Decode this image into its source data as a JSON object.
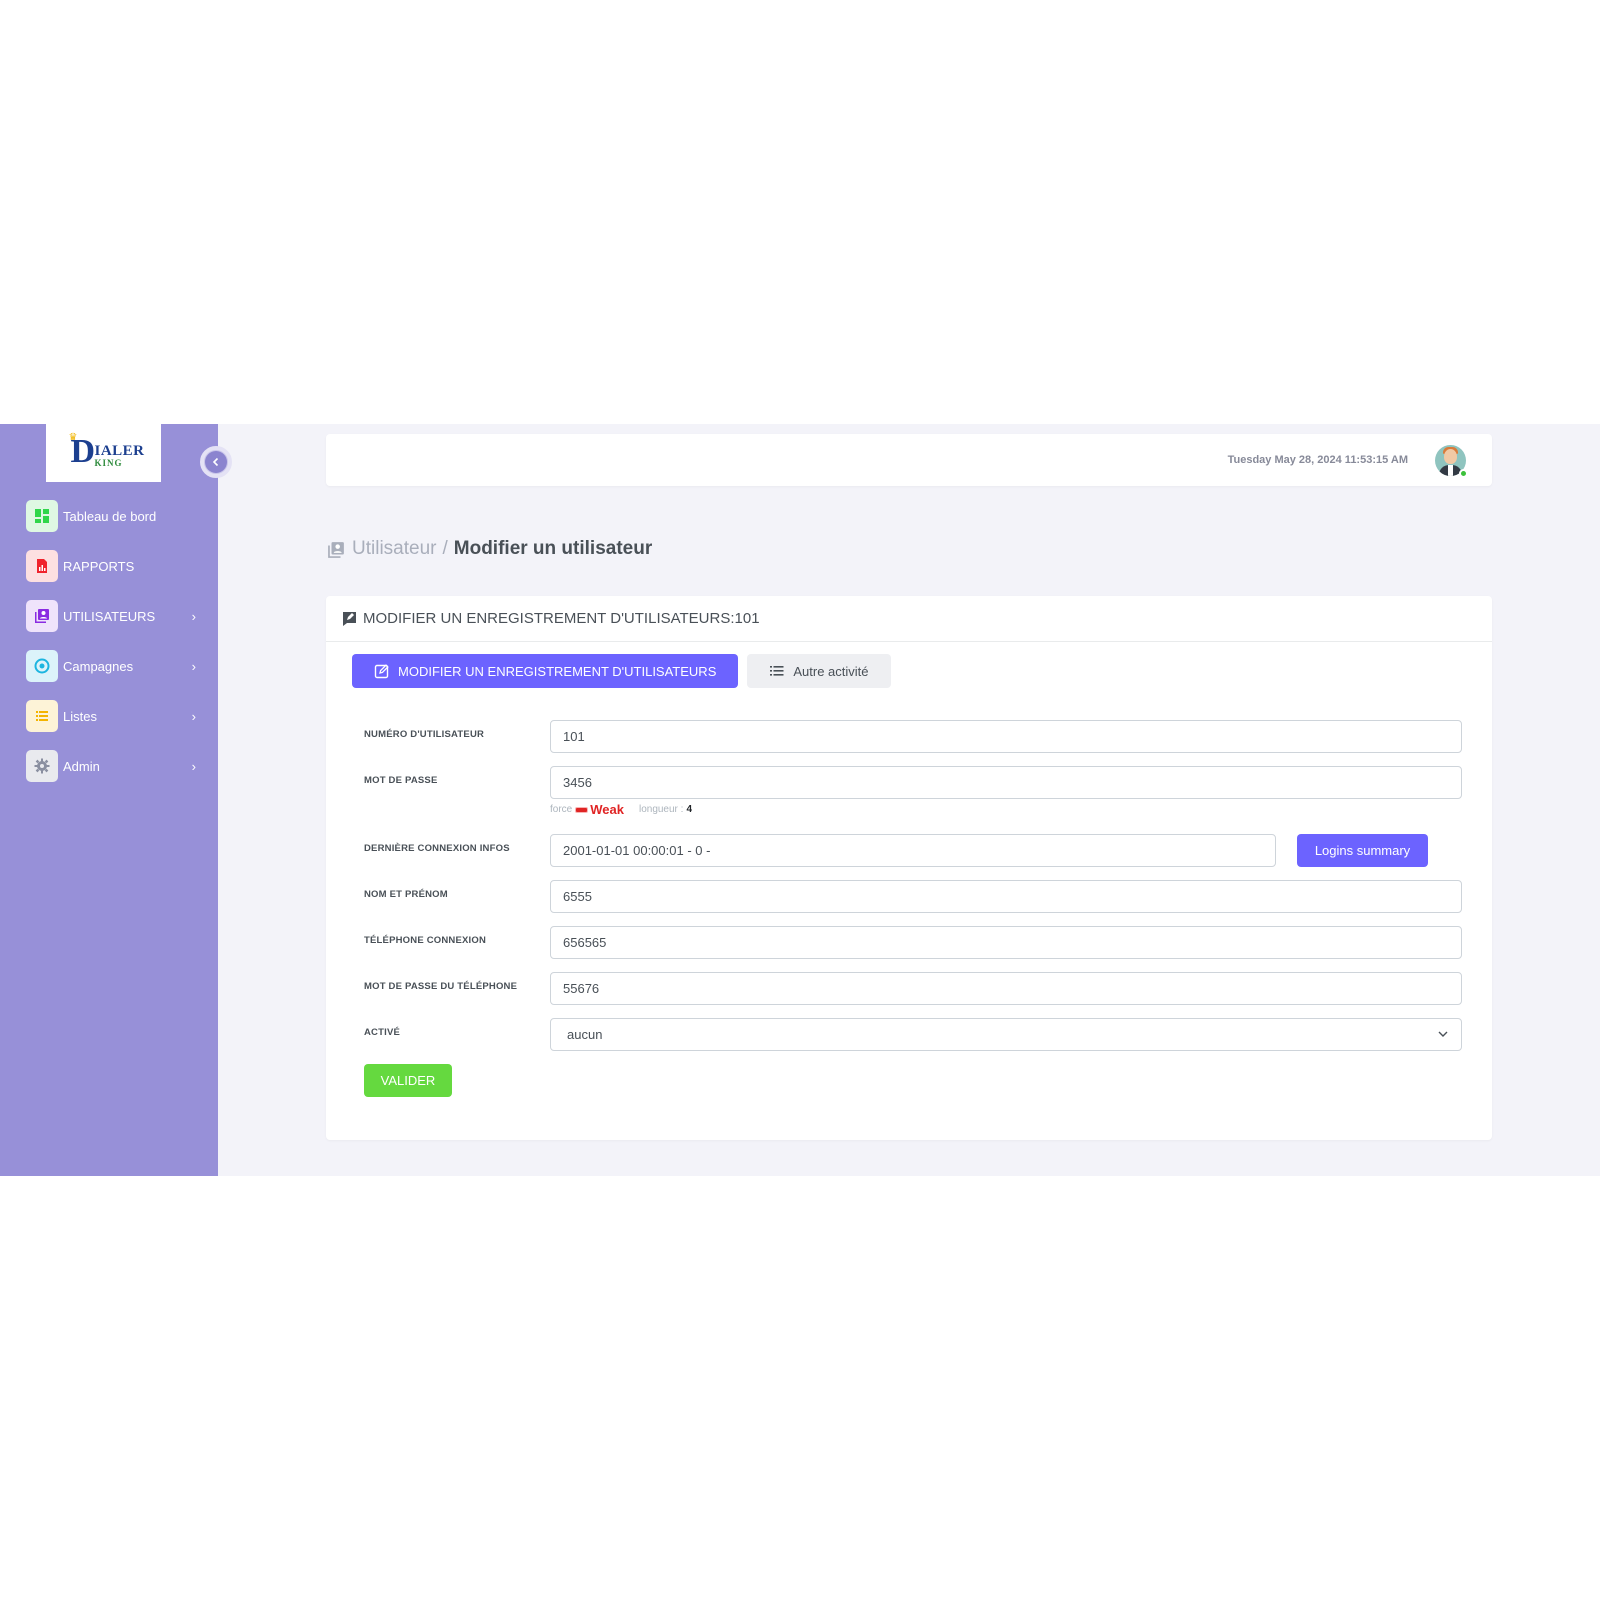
{
  "brand": {
    "logo_letter": "D",
    "logo_text_1": "IALER",
    "logo_text_2": "KING"
  },
  "sidebar": {
    "items": [
      {
        "label": "Tableau de bord",
        "icon": "dashboard-icon",
        "color": "#2fd64a",
        "bg": "#dff8e3",
        "has_submenu": false
      },
      {
        "label": "RAPPORTS",
        "icon": "report-file-icon",
        "color": "#f0232c",
        "bg": "#fde0e1",
        "has_submenu": false
      },
      {
        "label": "UTILISATEURS",
        "icon": "users-icon",
        "color": "#8a2be2",
        "bg": "#efe3fb",
        "has_submenu": true
      },
      {
        "label": "Campagnes",
        "icon": "target-icon",
        "color": "#1cb5e0",
        "bg": "#dcf3fa",
        "has_submenu": true
      },
      {
        "label": "Listes",
        "icon": "list-icon",
        "color": "#f4b400",
        "bg": "#fdf3d7",
        "has_submenu": true
      },
      {
        "label": "Admin",
        "icon": "gear-icon",
        "color": "#8a8fa0",
        "bg": "#e9eaee",
        "has_submenu": true
      }
    ]
  },
  "topbar": {
    "datetime": "Tuesday May 28, 2024 11:53:15 AM"
  },
  "breadcrumb": {
    "parent": "Utilisateur",
    "separator": "/",
    "current": "Modifier un utilisateur"
  },
  "card": {
    "title": "MODIFIER UN ENREGISTREMENT D'UTILISATEURS:101",
    "tabs": {
      "active": "MODIFIER UN ENREGISTREMENT D'UTILISATEURS",
      "other": "Autre activité"
    }
  },
  "form": {
    "user_number": {
      "label": "NUMÉRO D'UTILISATEUR",
      "value": "101"
    },
    "password": {
      "label": "MOT DE PASSE",
      "value": "3456",
      "strength_label": "force",
      "strength_value": "Weak",
      "length_label": "longueur :",
      "length_value": "4"
    },
    "last_login": {
      "label": "DERNIÈRE CONNEXION INFOS",
      "value": "2001-01-01 00:00:01 - 0 -",
      "button": "Logins summary"
    },
    "full_name": {
      "label": "NOM ET PRÉNOM",
      "value": "6555"
    },
    "phone_login": {
      "label": "TÉLÉPHONE CONNEXION",
      "value": "656565"
    },
    "phone_password": {
      "label": "MOT DE PASSE DU TÉLÉPHONE",
      "value": "55676"
    },
    "active": {
      "label": "ACTIVÉ",
      "value": "aucun"
    },
    "submit": "VALIDER"
  },
  "colors": {
    "sidebar_bg": "#9790d8",
    "primary": "#6c63ff",
    "success": "#65d93f",
    "danger": "#e02424"
  }
}
